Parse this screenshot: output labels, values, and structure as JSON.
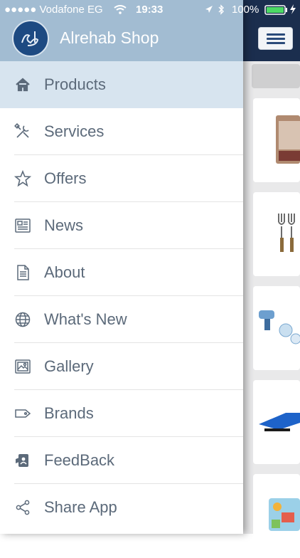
{
  "status_bar": {
    "carrier": "●●●●● Vodafone EG",
    "time": "19:33",
    "battery": "100%"
  },
  "drawer": {
    "app_title": "Alrehab Shop",
    "items": [
      {
        "label": "Products",
        "icon": "home-icon",
        "active": true
      },
      {
        "label": "Services",
        "icon": "tools-icon"
      },
      {
        "label": "Offers",
        "icon": "star-icon"
      },
      {
        "label": "News",
        "icon": "newspaper-icon"
      },
      {
        "label": "About",
        "icon": "document-icon"
      },
      {
        "label": "What's New",
        "icon": "globe-icon"
      },
      {
        "label": "Gallery",
        "icon": "image-icon"
      },
      {
        "label": "Brands",
        "icon": "tag-icon"
      },
      {
        "label": "FeedBack",
        "icon": "feedback-icon"
      },
      {
        "label": "Share App",
        "icon": "share-icon"
      }
    ]
  },
  "colors": {
    "header": "#a2bcd2",
    "active_item": "#d7e4ef",
    "app_bar": "#1b2e4e",
    "label": "#5c6a7a"
  }
}
